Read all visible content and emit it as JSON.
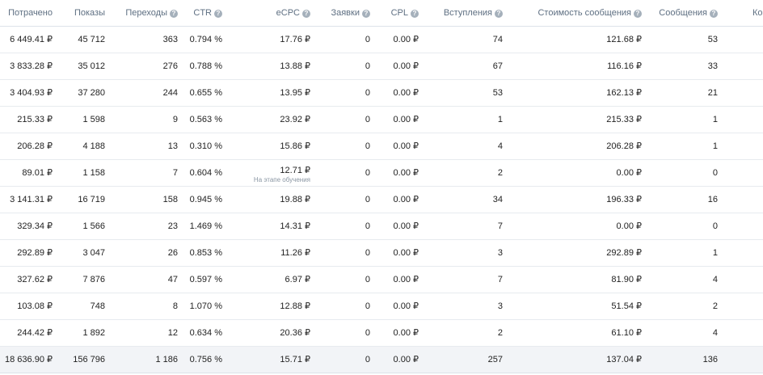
{
  "columns": [
    {
      "label": "Потрачено",
      "help": false
    },
    {
      "label": "Показы",
      "help": false
    },
    {
      "label": "Переходы",
      "help": true
    },
    {
      "label": "CTR",
      "help": true
    },
    {
      "label": "eCPC",
      "help": true
    },
    {
      "label": "Заявки",
      "help": true
    },
    {
      "label": "CPL",
      "help": true
    },
    {
      "label": "Вступления",
      "help": true
    },
    {
      "label": "Стоимость сообщения",
      "help": true
    },
    {
      "label": "Сообщения",
      "help": true
    },
    {
      "label": "Ко",
      "help": false
    }
  ],
  "help_glyph": "?",
  "rows": [
    [
      "6 449.41 ₽",
      "45 712",
      "363",
      "0.794 %",
      "17.76 ₽",
      "0",
      "0.00 ₽",
      "74",
      "121.68 ₽",
      "53"
    ],
    [
      "3 833.28 ₽",
      "35 012",
      "276",
      "0.788 %",
      "13.88 ₽",
      "0",
      "0.00 ₽",
      "67",
      "116.16 ₽",
      "33"
    ],
    [
      "3 404.93 ₽",
      "37 280",
      "244",
      "0.655 %",
      "13.95 ₽",
      "0",
      "0.00 ₽",
      "53",
      "162.13 ₽",
      "21"
    ],
    [
      "215.33 ₽",
      "1 598",
      "9",
      "0.563 %",
      "23.92 ₽",
      "0",
      "0.00 ₽",
      "1",
      "215.33 ₽",
      "1"
    ],
    [
      "206.28 ₽",
      "4 188",
      "13",
      "0.310 %",
      "15.86 ₽",
      "0",
      "0.00 ₽",
      "4",
      "206.28 ₽",
      "1"
    ],
    [
      "89.01 ₽",
      "1 158",
      "7",
      "0.604 %",
      "12.71 ₽",
      "0",
      "0.00 ₽",
      "2",
      "0.00 ₽",
      "0"
    ],
    [
      "3 141.31 ₽",
      "16 719",
      "158",
      "0.945 %",
      "19.88 ₽",
      "0",
      "0.00 ₽",
      "34",
      "196.33 ₽",
      "16"
    ],
    [
      "329.34 ₽",
      "1 566",
      "23",
      "1.469 %",
      "14.31 ₽",
      "0",
      "0.00 ₽",
      "7",
      "0.00 ₽",
      "0"
    ],
    [
      "292.89 ₽",
      "3 047",
      "26",
      "0.853 %",
      "11.26 ₽",
      "0",
      "0.00 ₽",
      "3",
      "292.89 ₽",
      "1"
    ],
    [
      "327.62 ₽",
      "7 876",
      "47",
      "0.597 %",
      "6.97 ₽",
      "0",
      "0.00 ₽",
      "7",
      "81.90 ₽",
      "4"
    ],
    [
      "103.08 ₽",
      "748",
      "8",
      "1.070 %",
      "12.88 ₽",
      "0",
      "0.00 ₽",
      "3",
      "51.54 ₽",
      "2"
    ],
    [
      "244.42 ₽",
      "1 892",
      "12",
      "0.634 %",
      "20.36 ₽",
      "0",
      "0.00 ₽",
      "2",
      "61.10 ₽",
      "4"
    ]
  ],
  "ecpc_notes": {
    "5": "На этапе обучения"
  },
  "total": [
    "18 636.90 ₽",
    "156 796",
    "1 186",
    "0.756 %",
    "15.71 ₽",
    "0",
    "0.00 ₽",
    "257",
    "137.04 ₽",
    "136"
  ]
}
